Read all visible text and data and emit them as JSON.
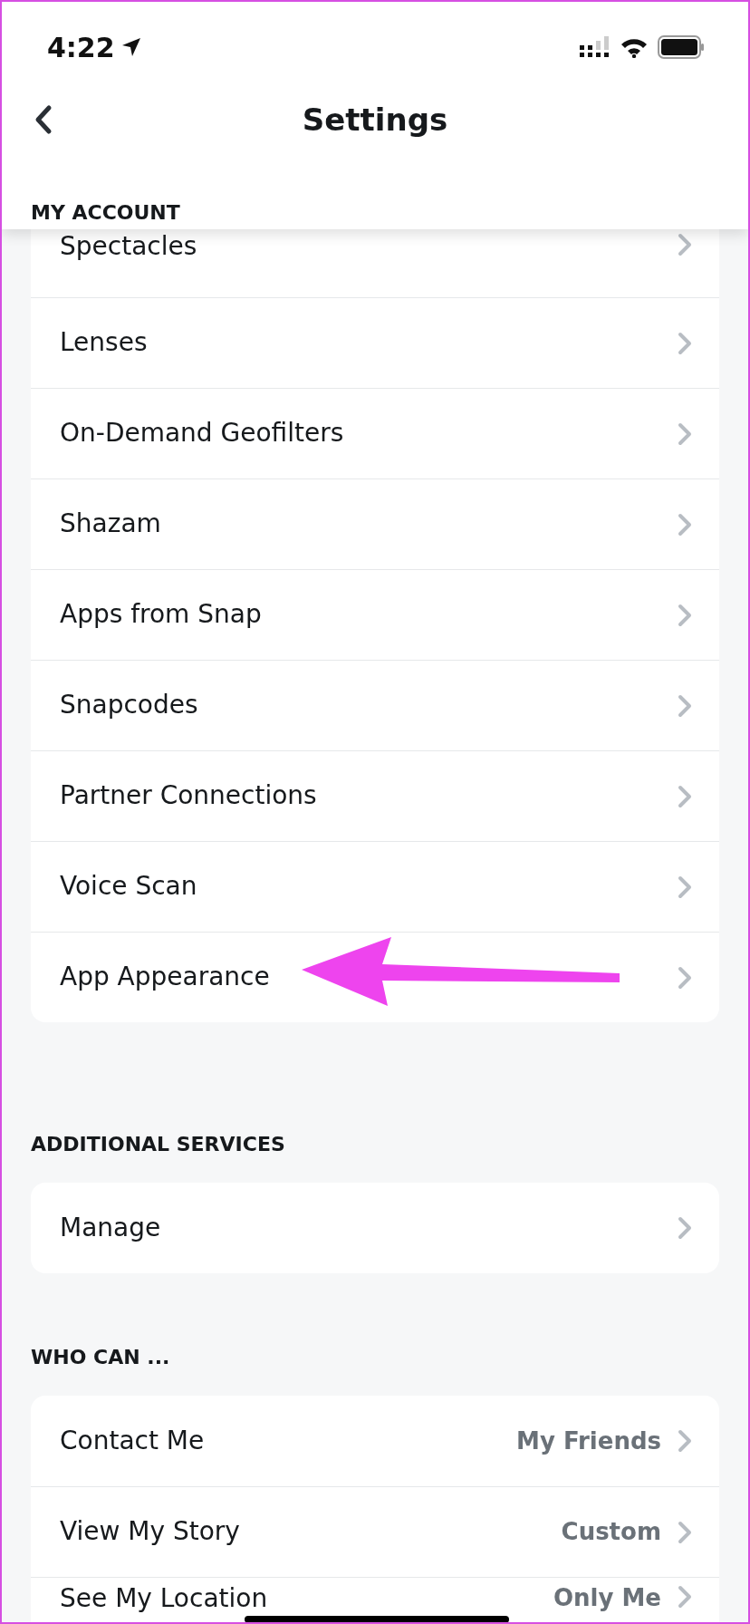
{
  "status_bar": {
    "time": "4:22"
  },
  "nav": {
    "title": "Settings"
  },
  "sections": [
    {
      "header": "MY ACCOUNT",
      "items": [
        {
          "label": "Spectacles"
        },
        {
          "label": "Lenses"
        },
        {
          "label": "On-Demand Geofilters"
        },
        {
          "label": "Shazam"
        },
        {
          "label": "Apps from Snap"
        },
        {
          "label": "Snapcodes"
        },
        {
          "label": "Partner Connections"
        },
        {
          "label": "Voice Scan"
        },
        {
          "label": "App Appearance"
        }
      ]
    },
    {
      "header": "ADDITIONAL SERVICES",
      "items": [
        {
          "label": "Manage"
        }
      ]
    },
    {
      "header": "WHO CAN ...",
      "items": [
        {
          "label": "Contact Me",
          "value": "My Friends"
        },
        {
          "label": "View My Story",
          "value": "Custom"
        },
        {
          "label": "See My Location",
          "value": "Only Me"
        }
      ]
    }
  ]
}
